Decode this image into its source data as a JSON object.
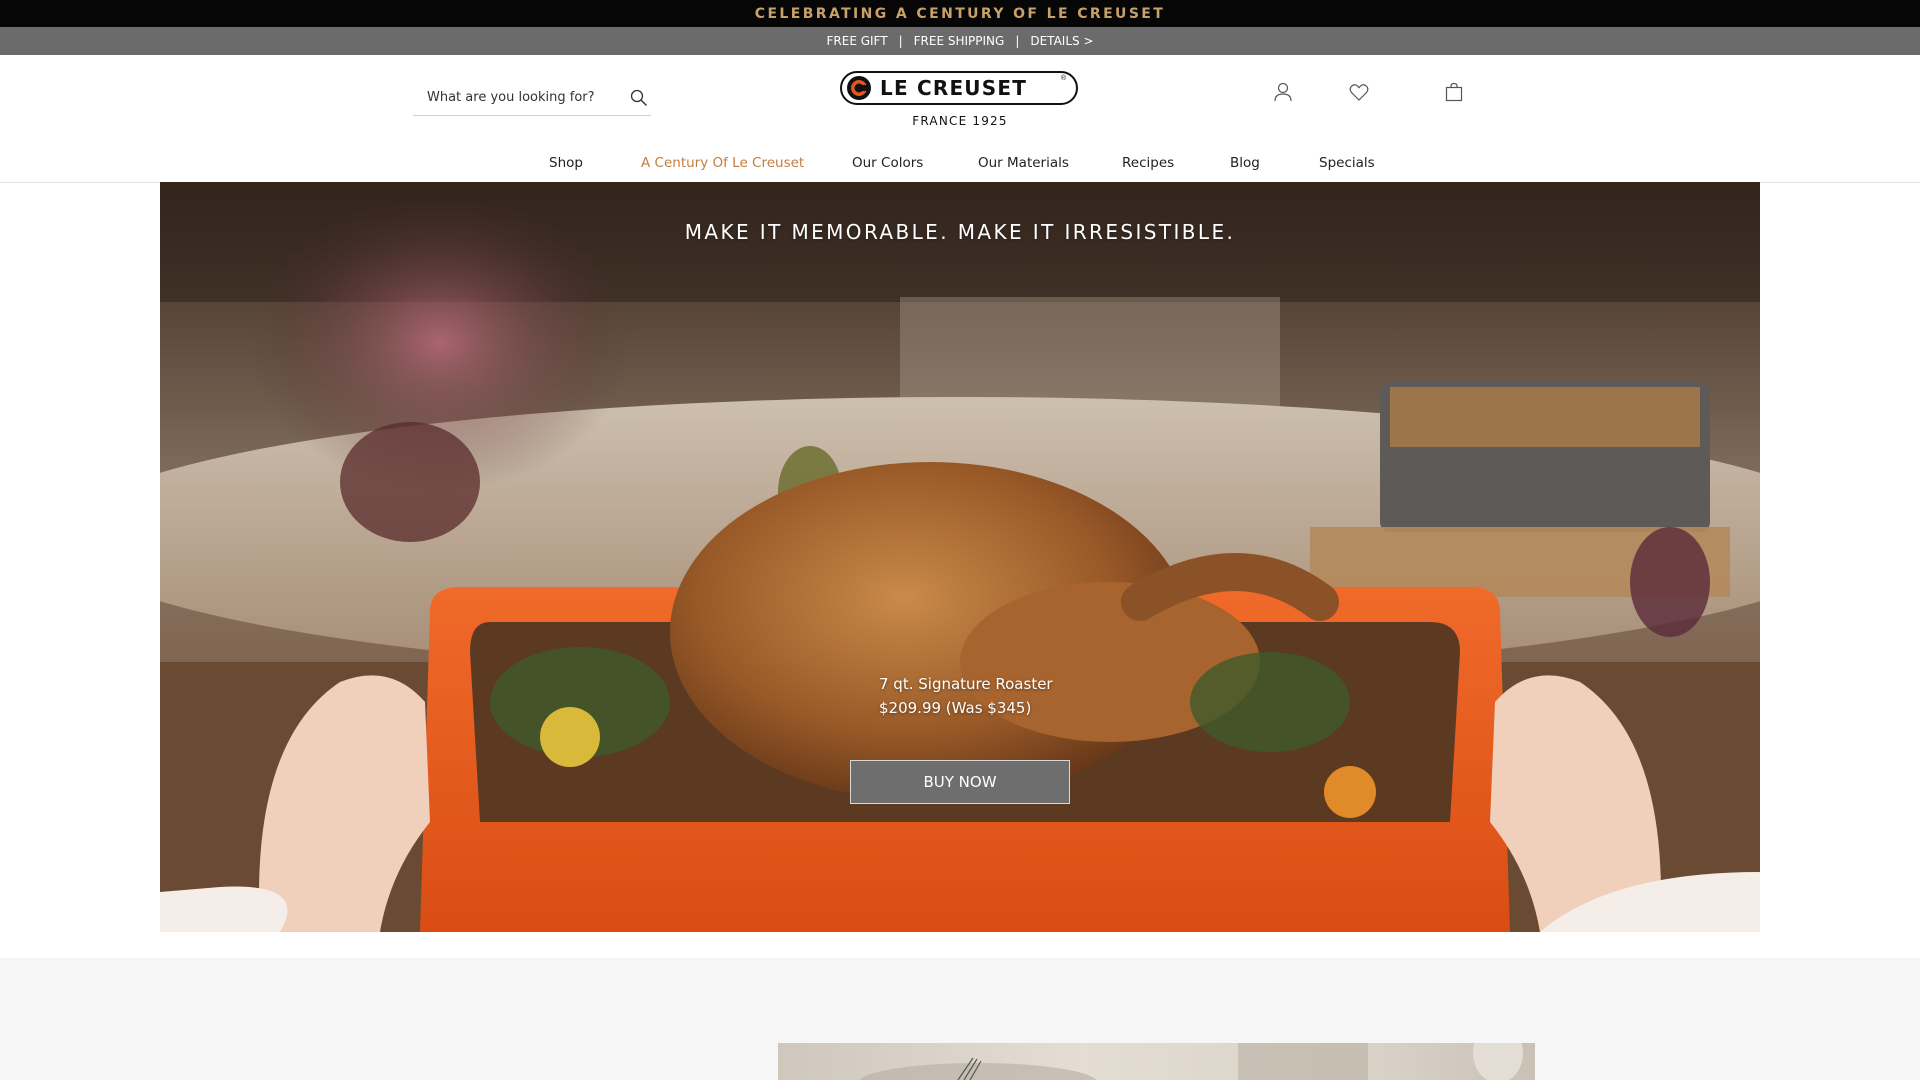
{
  "announcement": {
    "text": "CELEBRATING A CENTURY OF LE CREUSET"
  },
  "promo": {
    "free_gift": "FREE GIFT",
    "separator": "|",
    "free_shipping": "FREE SHIPPING",
    "details": "DETAILS >"
  },
  "header": {
    "search_placeholder": "What are you looking for?",
    "logo_text": "LE CREUSET",
    "logo_registered": "®",
    "logo_tagline": "FRANCE 1925",
    "icons": [
      "account-icon",
      "heart-icon",
      "bag-icon"
    ]
  },
  "nav": {
    "items": [
      "Shop",
      "A Century Of Le Creuset",
      "Our Colors",
      "Our Materials",
      "Recipes",
      "Blog",
      "Specials"
    ],
    "active_index": 1
  },
  "hero": {
    "headline": "MAKE IT MEMORABLE. MAKE IT IRRESISTIBLE.",
    "product_name": "7 qt. Signature Roaster",
    "product_price": "$209.99 (Was $345)",
    "cta": "BUY NOW"
  },
  "colors": {
    "accent": "#c47d3f",
    "announcement_bg": "#060606",
    "promo_bg": "#6b6b6b",
    "roaster_orange": "#e8551d"
  }
}
